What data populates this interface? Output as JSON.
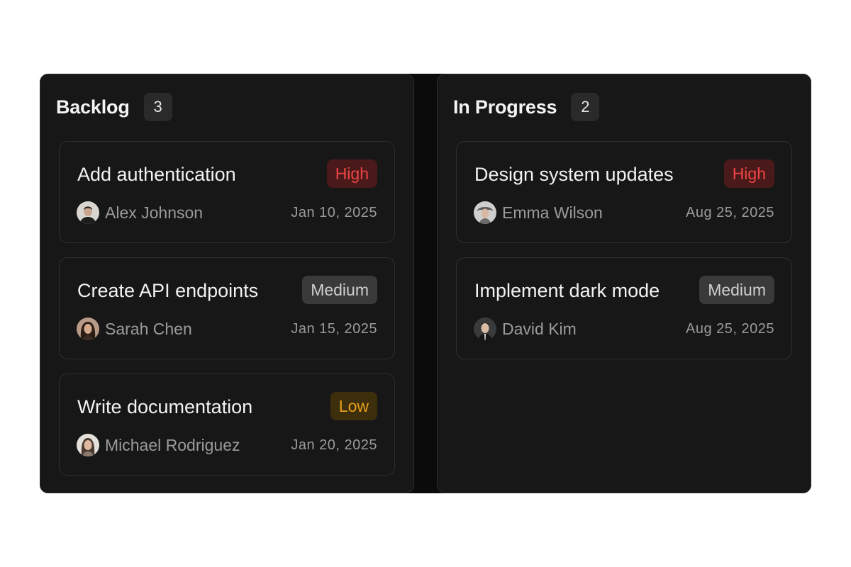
{
  "columns": [
    {
      "title": "Backlog",
      "count": "3",
      "cards": [
        {
          "title": "Add authentication",
          "priority": "High",
          "assignee": "Alex Johnson",
          "date": "Jan 10, 2025"
        },
        {
          "title": "Create API endpoints",
          "priority": "Medium",
          "assignee": "Sarah Chen",
          "date": "Jan 15, 2025"
        },
        {
          "title": "Write documentation",
          "priority": "Low",
          "assignee": "Michael Rodriguez",
          "date": "Jan 20, 2025"
        }
      ]
    },
    {
      "title": "In Progress",
      "count": "2",
      "cards": [
        {
          "title": "Design system updates",
          "priority": "High",
          "assignee": "Emma Wilson",
          "date": "Aug 25, 2025"
        },
        {
          "title": "Implement dark mode",
          "priority": "Medium",
          "assignee": "David Kim",
          "date": "Aug 25, 2025"
        }
      ]
    }
  ],
  "colors": {
    "high_text": "#ef4444",
    "high_bg": "#4a1a1a",
    "medium_text": "#cfcfcf",
    "medium_bg": "#3a3a3a",
    "low_text": "#e6a01c",
    "low_bg": "#3d2e0c"
  },
  "icons": {
    "avatar": "user-avatar-photo"
  }
}
